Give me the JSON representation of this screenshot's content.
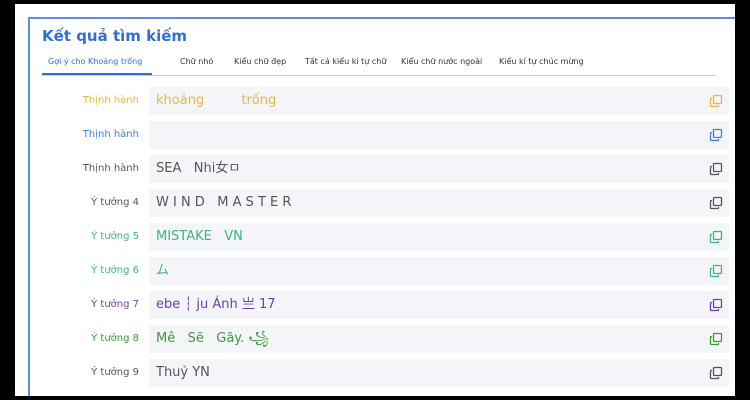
{
  "header": {
    "title": "Kết quả tìm kiếm"
  },
  "tabs": [
    {
      "label": "Gợi ý cho Khoảng trống",
      "active": true
    },
    {
      "label": "Chữ nhỏ"
    },
    {
      "label": "Kiểu chữ đẹp"
    },
    {
      "label": "Tất cả kiểu kí tự chữ"
    },
    {
      "label": "Kiểu chữ nước ngoài"
    },
    {
      "label": "Kiểu kí tự chúc mừng"
    }
  ],
  "results": [
    {
      "label": "Thịnh hành",
      "text": "khoảng         trống",
      "color": "#f0b43c",
      "icon": "copy-icon"
    },
    {
      "label": "Thịnh hành",
      "text": "",
      "color": "#3d7fd8",
      "icon": "copy-icon"
    },
    {
      "label": "Thịnh hành",
      "text": "SEA   Nhi女ㅁ",
      "color": "#555555",
      "icon": "copy-icon"
    },
    {
      "label": "Ý tưởng 4",
      "text": "W I N D   M A S T E R",
      "color": "#555555",
      "icon": "copy-icon"
    },
    {
      "label": "Ý tưởng 5",
      "text": "MISTAKE   VN",
      "color": "#3fb27f",
      "icon": "copy-icon"
    },
    {
      "label": "Ý tưởng 6",
      "text": "ム",
      "color": "#3fb27f",
      "icon": "copy-icon"
    },
    {
      "label": "Ý tưởng 7",
      "text": "ebe ┆ ju Ánh 亗 17",
      "color": "#6a3fb0",
      "icon": "copy-icon"
    },
    {
      "label": "Ý tưởng 8",
      "text": "Mê   Sẽ   Gãy. ꧁",
      "color": "#3a9a3a",
      "icon": "copy-icon"
    },
    {
      "label": "Ý tưởng 9",
      "text": "Thuỷ YN",
      "color": "#555555",
      "icon": "copy-icon"
    }
  ],
  "colors": {
    "accent": "#2f6fd6",
    "border": "#5b8fdc",
    "row_bg": "#f4f5f8"
  }
}
